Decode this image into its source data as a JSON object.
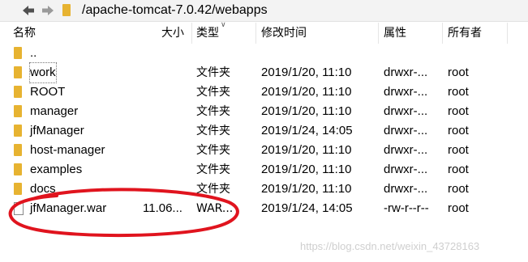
{
  "path_bar": {
    "path": "/apache-tomcat-7.0.42/webapps"
  },
  "columns": {
    "name": "名称",
    "size": "大小",
    "type": "类型",
    "modified": "修改时间",
    "permissions": "属性",
    "owner": "所有者"
  },
  "rows": [
    {
      "kind": "folder",
      "name": "..",
      "size": "",
      "type": "",
      "modified": "",
      "permissions": "",
      "owner": ""
    },
    {
      "kind": "folder",
      "name": "work",
      "size": "",
      "type": "文件夹",
      "modified": "2019/1/20, 11:10",
      "permissions": "drwxr-...",
      "owner": "root"
    },
    {
      "kind": "folder",
      "name": "ROOT",
      "size": "",
      "type": "文件夹",
      "modified": "2019/1/20, 11:10",
      "permissions": "drwxr-...",
      "owner": "root"
    },
    {
      "kind": "folder",
      "name": "manager",
      "size": "",
      "type": "文件夹",
      "modified": "2019/1/20, 11:10",
      "permissions": "drwxr-...",
      "owner": "root"
    },
    {
      "kind": "folder",
      "name": "jfManager",
      "size": "",
      "type": "文件夹",
      "modified": "2019/1/24, 14:05",
      "permissions": "drwxr-...",
      "owner": "root"
    },
    {
      "kind": "folder",
      "name": "host-manager",
      "size": "",
      "type": "文件夹",
      "modified": "2019/1/20, 11:10",
      "permissions": "drwxr-...",
      "owner": "root"
    },
    {
      "kind": "folder",
      "name": "examples",
      "size": "",
      "type": "文件夹",
      "modified": "2019/1/20, 11:10",
      "permissions": "drwxr-...",
      "owner": "root"
    },
    {
      "kind": "folder",
      "name": "docs",
      "size": "",
      "type": "文件夹",
      "modified": "2019/1/20, 11:10",
      "permissions": "drwxr-...",
      "owner": "root"
    },
    {
      "kind": "file",
      "name": "jfManager.war",
      "size": "11.06...",
      "type": "WAR...",
      "modified": "2019/1/24, 14:05",
      "permissions": "-rw-r--r--",
      "owner": "root"
    }
  ],
  "watermark": "https://blog.csdn.net/weixin_43728163",
  "colors": {
    "folder": "#e7b331",
    "annotation": "#e0141e",
    "toolbar_bg": "#f3f3f3"
  }
}
